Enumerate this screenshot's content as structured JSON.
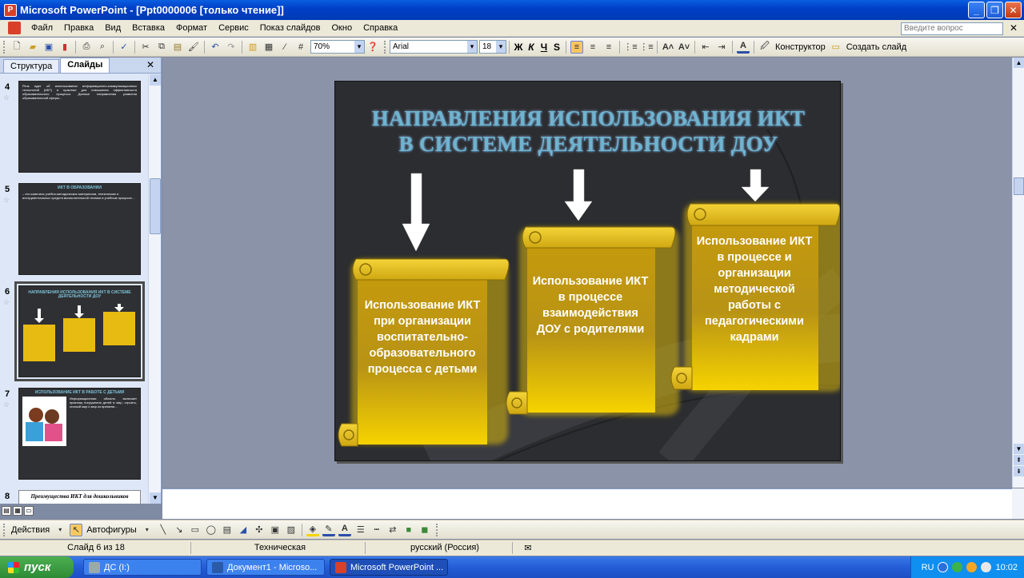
{
  "window": {
    "title": "Microsoft PowerPoint - [Ppt0000006 [только чтение]]"
  },
  "menu": {
    "items": [
      "Файл",
      "Правка",
      "Вид",
      "Вставка",
      "Формат",
      "Сервис",
      "Показ слайдов",
      "Окно",
      "Справка"
    ],
    "question_placeholder": "Введите вопрос"
  },
  "toolbar": {
    "zoom": "70%",
    "font": "Arial",
    "font_size": "18",
    "bold": "Ж",
    "italic": "К",
    "underline": "Ч",
    "shadow": "S",
    "designer_label": "Конструктор",
    "new_slide_label": "Создать слайд"
  },
  "left_panel": {
    "tabs": [
      "Структура",
      "Слайды"
    ],
    "thumbnails": [
      {
        "num": "4",
        "text": "Речь идет об использовании информационно-коммуникационных технологий (ИКТ) в практике для повышения эффективности образовательного процесса. Данные направления развития образовательной сферы..."
      },
      {
        "num": "5",
        "title": "ИКТ В ОБРАЗОВАНИИ",
        "text": "– это комплекс учебно-методических материалов, технических и инструментальных средств вычислительной техники в учебном процессе..."
      },
      {
        "num": "6",
        "title": "НАПРАВЛЕНИЯ ИСПОЛЬЗОВАНИЯ ИКТ В СИСТЕМЕ ДЕЯТЕЛЬНОСТИ ДОУ"
      },
      {
        "num": "7",
        "title": "ИСПОЛЬЗОВАНИЕ ИКТ В РАБОТЕ С ДЕТЬМИ",
        "text": "Информационная область включает практику погружения детей в мир, строить, личный мир и мир из времени..."
      },
      {
        "num": "8",
        "title": "Преимущества ИКТ для дошкольников"
      }
    ]
  },
  "slide": {
    "title_line1": "НАПРАВЛЕНИЯ ИСПОЛЬЗОВАНИЯ ИКТ",
    "title_line2": "В СИСТЕМЕ ДЕЯТЕЛЬНОСТИ ДОУ",
    "scroll1": "Использование ИКТ при организации воспитательно-образовательного процесса с детьми",
    "scroll2": "Использование ИКТ в процессе взаимодействия ДОУ с родителями",
    "scroll3": "Использование ИКТ в  процессе и организации методической работы с педагогическими кадрами"
  },
  "drawing_toolbar": {
    "actions": "Действия",
    "autoshapes": "Автофигуры"
  },
  "status": {
    "slide": "Слайд 6 из 18",
    "design": "Техническая",
    "language": "русский (Россия)"
  },
  "taskbar": {
    "start": "пуск",
    "tasks": [
      "ДС (I:)",
      "Документ1 - Microso...",
      "Microsoft PowerPoint ..."
    ],
    "lang": "RU",
    "clock": "10:02"
  }
}
